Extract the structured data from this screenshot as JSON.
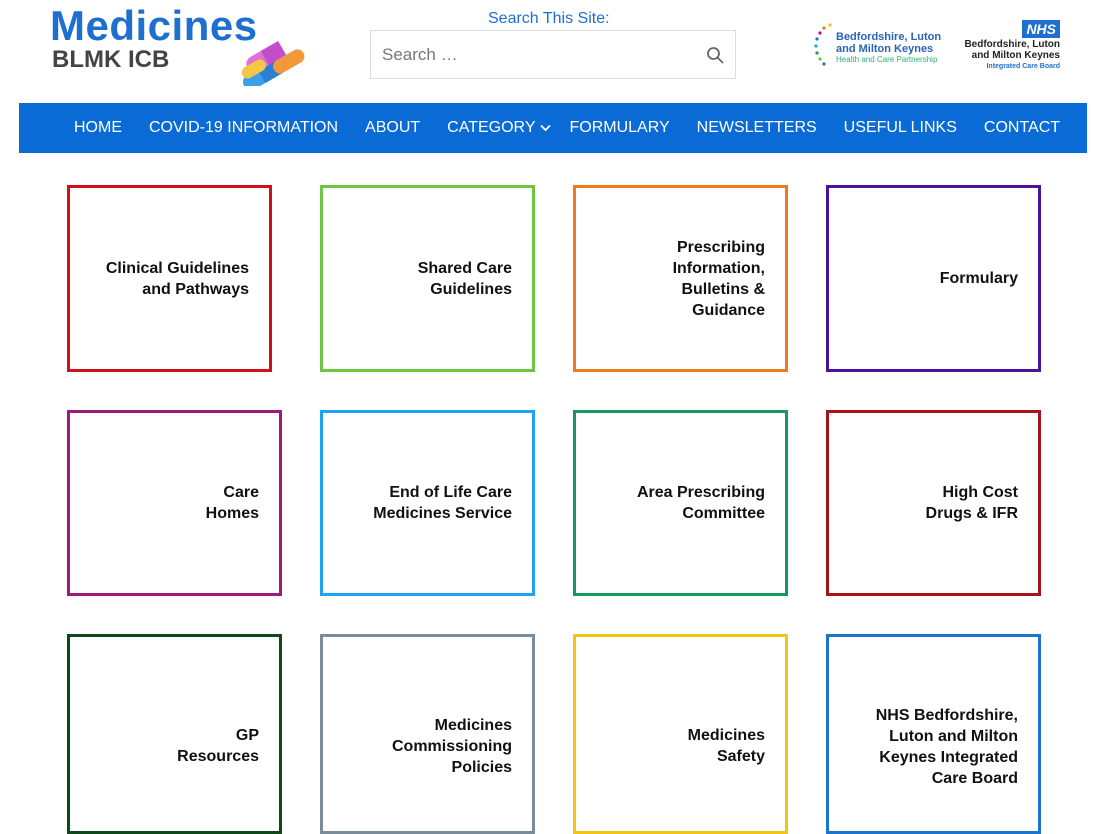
{
  "header": {
    "logo_title": "Medicines",
    "logo_subtitle": "BLMK ICB",
    "search_label": "Search This Site:",
    "search_placeholder": "Search …",
    "partner_logo": {
      "line1": "Bedfordshire, Luton",
      "line2": "and Milton Keynes",
      "line3": "Health and Care Partnership"
    },
    "nhs_logo": {
      "badge": "NHS",
      "line1": "Bedfordshire, Luton",
      "line2": "and Milton Keynes",
      "line3": "Integrated Care Board"
    }
  },
  "nav": {
    "items": [
      {
        "label": "HOME"
      },
      {
        "label": "COVID-19 INFORMATION"
      },
      {
        "label": "ABOUT"
      },
      {
        "label": "CATEGORY",
        "has_dropdown": true
      },
      {
        "label": "FORMULARY"
      },
      {
        "label": "NEWSLETTERS"
      },
      {
        "label": "USEFUL LINKS"
      },
      {
        "label": "CONTACT"
      }
    ]
  },
  "colors": {
    "brand_blue": "#0a6bd6",
    "tile_borders": [
      "#d0101a",
      "#6cc644",
      "#f07a1a",
      "#4a149a",
      "#9c1a7a",
      "#1ea3f2",
      "#1a9660",
      "#a8141c",
      "#0f4818",
      "#7a8c99",
      "#f2c414",
      "#1a73cc"
    ]
  },
  "tiles": [
    {
      "label": "Clinical Guidelines\nand Pathways"
    },
    {
      "label": "Shared Care\nGuidelines"
    },
    {
      "label": "Prescribing\nInformation,\nBulletins &\nGuidance"
    },
    {
      "label": "Formulary"
    },
    {
      "label": "Care\nHomes"
    },
    {
      "label": "End of Life Care\nMedicines Service"
    },
    {
      "label": "Area Prescribing\nCommittee"
    },
    {
      "label": "High Cost\nDrugs & IFR"
    },
    {
      "label": "GP\nResources"
    },
    {
      "label": "Medicines\nCommissioning\nPolicies"
    },
    {
      "label": "Medicines\nSafety"
    },
    {
      "label": "NHS Bedfordshire,\nLuton and Milton\nKeynes Integrated\nCare Board"
    }
  ]
}
